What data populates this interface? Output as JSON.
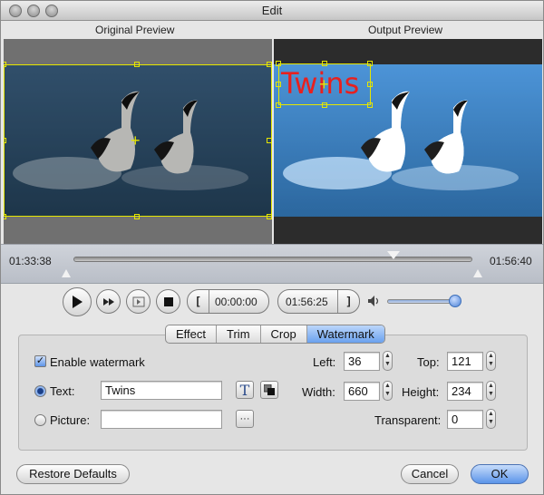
{
  "window": {
    "title": "Edit"
  },
  "preview": {
    "original_label": "Original Preview",
    "output_label": "Output Preview",
    "watermark_text": "Twins"
  },
  "timeline": {
    "start_time": "01:33:38",
    "end_time": "01:56:40"
  },
  "playback": {
    "play_icon": "play-icon",
    "next_frame_icon": "fast-forward-icon",
    "step_icon": "step-frame-icon",
    "stop_icon": "stop-icon",
    "mark_in_glyph": "[",
    "current_time": "00:00:00",
    "duration_time": "01:56:25",
    "mark_out_glyph": "]",
    "volume_icon": "speaker-icon",
    "volume_level": 0.9
  },
  "tabs": [
    {
      "label": "Effect",
      "active": false
    },
    {
      "label": "Trim",
      "active": false
    },
    {
      "label": "Crop",
      "active": false
    },
    {
      "label": "Watermark",
      "active": true
    }
  ],
  "watermark": {
    "enable_label": "Enable watermark",
    "enabled": true,
    "text_label": "Text:",
    "text_value": "Twins",
    "text_selected": true,
    "font_button_glyph": "T",
    "picture_label": "Picture:",
    "picture_value": "",
    "browse_glyph": "···",
    "left_label": "Left:",
    "left_value": "36",
    "top_label": "Top:",
    "top_value": "121",
    "width_label": "Width:",
    "width_value": "660",
    "height_label": "Height:",
    "height_value": "234",
    "transparent_label": "Transparent:",
    "transparent_value": "0"
  },
  "buttons": {
    "restore": "Restore Defaults",
    "cancel": "Cancel",
    "ok": "OK"
  },
  "colors": {
    "watermark_text": "#e8201e",
    "selection": "#e6e600",
    "accent": "#5b94e9"
  }
}
